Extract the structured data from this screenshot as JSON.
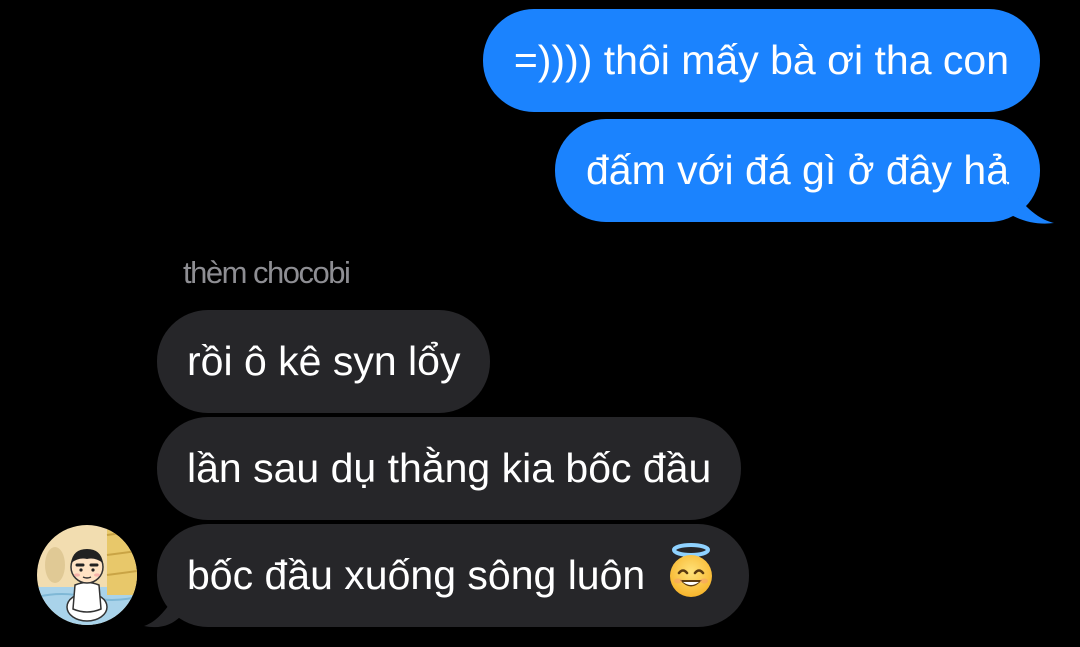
{
  "conversation": {
    "outgoing": [
      {
        "text": "=)))) thôi mấy bà ơi tha con"
      },
      {
        "text": "đấm với đá gì ở đây hả"
      }
    ],
    "sender_name": "thèm chocobi",
    "incoming": [
      {
        "text": "rồi ô kê syn lổy"
      },
      {
        "text": "lần sau dụ thằng kia bốc đầu"
      },
      {
        "text": "bốc đầu xuống sông luôn",
        "emoji": "smiling-face-with-halo"
      }
    ]
  },
  "colors": {
    "background": "#000000",
    "outgoing_bubble": "#1b83fe",
    "incoming_bubble": "#262629",
    "message_text": "#ffffff",
    "sender_name": "#8e8e93"
  },
  "icons": {
    "avatar": "cartoon-character-avatar",
    "emoji": "smiling-face-with-halo"
  }
}
